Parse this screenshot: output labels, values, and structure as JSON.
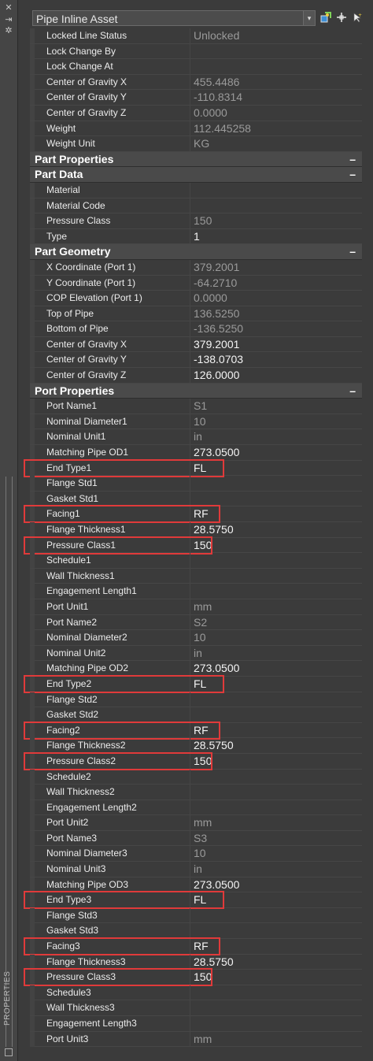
{
  "palette": {
    "vertical_title": "PROPERTIES"
  },
  "selector": {
    "value": "Pipe Inline Asset",
    "arrow": "▾"
  },
  "icons": {
    "close": "close-icon",
    "autohide": "pin-icon",
    "settings": "gear-icon",
    "toolbar": [
      "quick-select-icon",
      "select-objects-icon",
      "toggle-pickadd-icon"
    ]
  },
  "colors": {
    "highlight": "#e03a3a",
    "background": "#3b3b3b"
  },
  "rows_top": [
    {
      "label": "Locked Line Status",
      "value": "Unlocked",
      "style": "dim"
    },
    {
      "label": "Lock Change By",
      "value": "",
      "style": "dim"
    },
    {
      "label": "Lock Change At",
      "value": "",
      "style": "dim"
    },
    {
      "label": "Center of Gravity X",
      "value": "455.4486",
      "style": "dim"
    },
    {
      "label": "Center of Gravity Y",
      "value": "-110.8314",
      "style": "dim"
    },
    {
      "label": "Center of Gravity Z",
      "value": "0.0000",
      "style": "dim"
    },
    {
      "label": "Weight",
      "value": "112.445258",
      "style": "dim"
    },
    {
      "label": "Weight Unit",
      "value": "KG",
      "style": "dim"
    }
  ],
  "sections": [
    {
      "title": "Part Properties",
      "toggle": "–",
      "rows": []
    },
    {
      "title": "Part Data",
      "toggle": "–",
      "rows": [
        {
          "label": "Material",
          "value": "",
          "style": "dim"
        },
        {
          "label": "Material Code",
          "value": "",
          "style": "dim"
        },
        {
          "label": "Pressure Class",
          "value": "150",
          "style": "dim"
        },
        {
          "label": "Type",
          "value": "1",
          "style": "bright"
        }
      ]
    },
    {
      "title": "Part Geometry",
      "toggle": "–",
      "rows": [
        {
          "label": "X Coordinate (Port 1)",
          "value": "379.2001",
          "style": "dim"
        },
        {
          "label": "Y Coordinate (Port 1)",
          "value": "-64.2710",
          "style": "dim"
        },
        {
          "label": "COP Elevation (Port 1)",
          "value": "0.0000",
          "style": "dim"
        },
        {
          "label": "Top of Pipe",
          "value": "136.5250",
          "style": "dim"
        },
        {
          "label": "Bottom of Pipe",
          "value": "-136.5250",
          "style": "dim"
        },
        {
          "label": "Center of Gravity X",
          "value": "379.2001",
          "style": "bright"
        },
        {
          "label": "Center of Gravity Y",
          "value": "-138.0703",
          "style": "bright"
        },
        {
          "label": "Center of Gravity Z",
          "value": "126.0000",
          "style": "bright"
        }
      ]
    },
    {
      "title": "Port Properties",
      "toggle": "–",
      "rows": [
        {
          "label": "Port Name1",
          "value": "S1",
          "style": "dim"
        },
        {
          "label": "Nominal Diameter1",
          "value": "10",
          "style": "dim"
        },
        {
          "label": "Nominal Unit1",
          "value": "in",
          "style": "dim"
        },
        {
          "label": "Matching Pipe OD1",
          "value": "273.0500",
          "style": "bright"
        },
        {
          "label": "End Type1",
          "value": "FL",
          "style": "bright",
          "hl": true
        },
        {
          "label": "Flange Std1",
          "value": "",
          "style": "dim"
        },
        {
          "label": "Gasket Std1",
          "value": "",
          "style": "dim"
        },
        {
          "label": "Facing1",
          "value": "RF",
          "style": "bright",
          "hl": true
        },
        {
          "label": "Flange Thickness1",
          "value": "28.5750",
          "style": "bright"
        },
        {
          "label": "Pressure Class1",
          "value": "150",
          "style": "bright",
          "hl": true
        },
        {
          "label": "Schedule1",
          "value": "",
          "style": "dim"
        },
        {
          "label": "Wall Thickness1",
          "value": "",
          "style": "dim"
        },
        {
          "label": "Engagement Length1",
          "value": "",
          "style": "dim"
        },
        {
          "label": "Port Unit1",
          "value": "mm",
          "style": "dim"
        },
        {
          "label": "Port Name2",
          "value": "S2",
          "style": "dim"
        },
        {
          "label": "Nominal Diameter2",
          "value": "10",
          "style": "dim"
        },
        {
          "label": "Nominal Unit2",
          "value": "in",
          "style": "dim"
        },
        {
          "label": "Matching Pipe OD2",
          "value": "273.0500",
          "style": "bright"
        },
        {
          "label": "End Type2",
          "value": "FL",
          "style": "bright",
          "hl": true
        },
        {
          "label": "Flange Std2",
          "value": "",
          "style": "dim"
        },
        {
          "label": "Gasket Std2",
          "value": "",
          "style": "dim"
        },
        {
          "label": "Facing2",
          "value": "RF",
          "style": "bright",
          "hl": true
        },
        {
          "label": "Flange Thickness2",
          "value": "28.5750",
          "style": "bright"
        },
        {
          "label": "Pressure Class2",
          "value": "150",
          "style": "bright",
          "hl": true
        },
        {
          "label": "Schedule2",
          "value": "",
          "style": "dim"
        },
        {
          "label": "Wall Thickness2",
          "value": "",
          "style": "dim"
        },
        {
          "label": "Engagement Length2",
          "value": "",
          "style": "dim"
        },
        {
          "label": "Port Unit2",
          "value": "mm",
          "style": "dim"
        },
        {
          "label": "Port Name3",
          "value": "S3",
          "style": "dim"
        },
        {
          "label": "Nominal Diameter3",
          "value": "10",
          "style": "dim"
        },
        {
          "label": "Nominal Unit3",
          "value": "in",
          "style": "dim"
        },
        {
          "label": "Matching Pipe OD3",
          "value": "273.0500",
          "style": "bright"
        },
        {
          "label": "End Type3",
          "value": "FL",
          "style": "bright",
          "hl": true
        },
        {
          "label": "Flange Std3",
          "value": "",
          "style": "dim"
        },
        {
          "label": "Gasket Std3",
          "value": "",
          "style": "dim"
        },
        {
          "label": "Facing3",
          "value": "RF",
          "style": "bright",
          "hl": true
        },
        {
          "label": "Flange Thickness3",
          "value": "28.5750",
          "style": "bright"
        },
        {
          "label": "Pressure Class3",
          "value": "150",
          "style": "bright",
          "hl": true
        },
        {
          "label": "Schedule3",
          "value": "",
          "style": "dim"
        },
        {
          "label": "Wall Thickness3",
          "value": "",
          "style": "dim"
        },
        {
          "label": "Engagement Length3",
          "value": "",
          "style": "dim"
        },
        {
          "label": "Port Unit3",
          "value": "mm",
          "style": "dim"
        }
      ]
    }
  ]
}
